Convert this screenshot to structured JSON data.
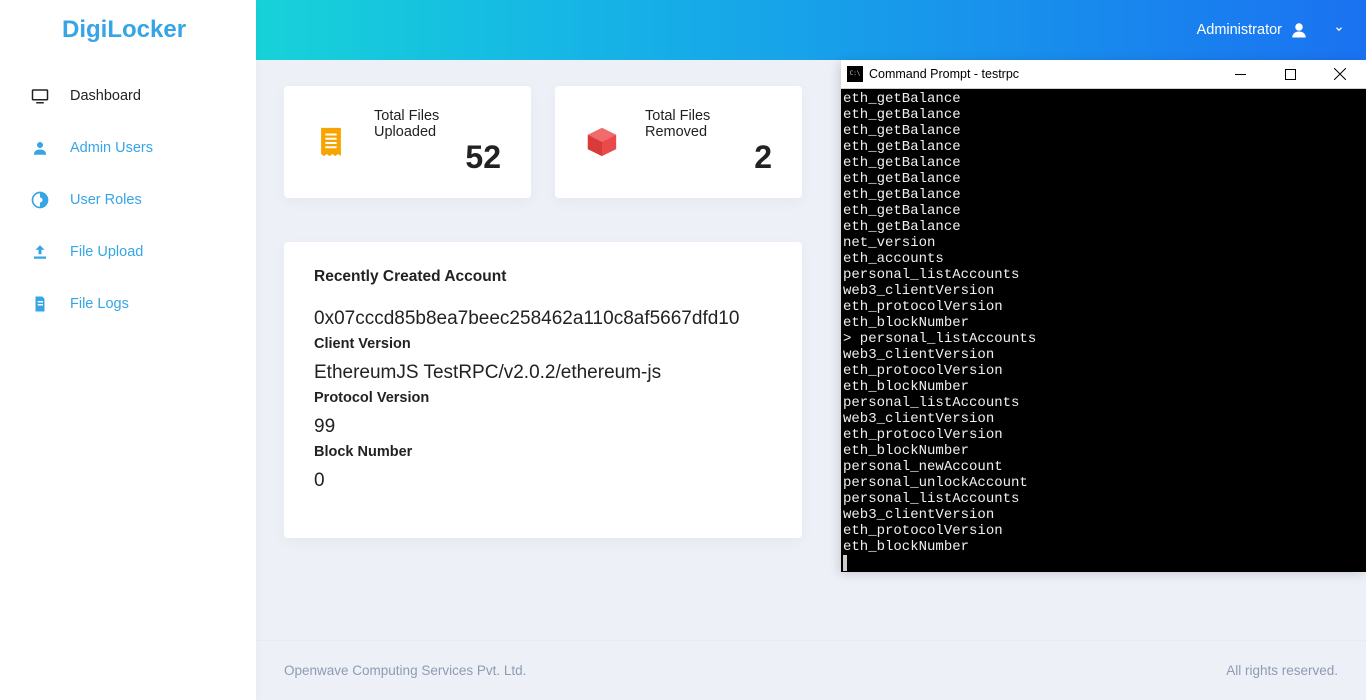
{
  "brand": "DigiLocker",
  "sidebar": {
    "items": [
      {
        "label": "Dashboard",
        "icon": "monitor-icon"
      },
      {
        "label": "Admin Users",
        "icon": "person-icon"
      },
      {
        "label": "User Roles",
        "icon": "roles-icon"
      },
      {
        "label": "File Upload",
        "icon": "upload-icon"
      },
      {
        "label": "File Logs",
        "icon": "file-icon"
      }
    ]
  },
  "topbar": {
    "user_label": "Administrator"
  },
  "stats": {
    "uploaded": {
      "label": "Total Files Uploaded",
      "value": "52"
    },
    "removed": {
      "label": "Total Files Removed",
      "value": "2"
    }
  },
  "account": {
    "title": "Recently Created Account",
    "address": "0x07cccd85b8ea7beec258462a110c8af5667dfd10",
    "client_version_label": "Client Version",
    "client_version": "EthereumJS TestRPC/v2.0.2/ethereum-js",
    "protocol_version_label": "Protocol Version",
    "protocol_version": "99",
    "block_number_label": "Block Number",
    "block_number": "0"
  },
  "footer": {
    "left": "Openwave Computing Services Pvt. Ltd.",
    "right": "All rights reserved."
  },
  "terminal": {
    "title": "Command Prompt - testrpc",
    "lines": [
      "eth_getBalance",
      "eth_getBalance",
      "eth_getBalance",
      "eth_getBalance",
      "eth_getBalance",
      "eth_getBalance",
      "eth_getBalance",
      "eth_getBalance",
      "eth_getBalance",
      "net_version",
      "eth_accounts",
      "personal_listAccounts",
      "web3_clientVersion",
      "eth_protocolVersion",
      "eth_blockNumber",
      "> personal_listAccounts",
      "web3_clientVersion",
      "eth_protocolVersion",
      "eth_blockNumber",
      "personal_listAccounts",
      "web3_clientVersion",
      "eth_protocolVersion",
      "eth_blockNumber",
      "personal_newAccount",
      "personal_unlockAccount",
      "personal_listAccounts",
      "web3_clientVersion",
      "eth_protocolVersion",
      "eth_blockNumber"
    ]
  }
}
